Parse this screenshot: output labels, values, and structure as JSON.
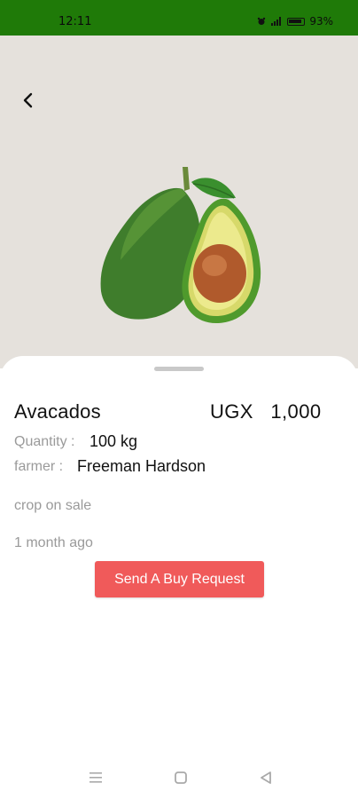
{
  "status_bar": {
    "time": "12:11",
    "battery": "93%"
  },
  "product": {
    "name": "Avacados",
    "price": "UGX   1,000",
    "quantity_label": "Quantity :",
    "quantity_value": "100 kg",
    "farmer_label": "farmer :",
    "farmer_value": "Freeman Hardson",
    "description": "crop on sale",
    "posted": "1 month ago",
    "button_label": "Send A Buy Request"
  },
  "colors": {
    "status_bar": "#1f7a08",
    "hero_bg": "#e5e1dc",
    "button": "#f05a5a"
  },
  "icons": {
    "back": "chevron-left-icon",
    "nav_menu": "menu-icon",
    "nav_home": "square-home-icon",
    "nav_back": "triangle-back-icon"
  }
}
